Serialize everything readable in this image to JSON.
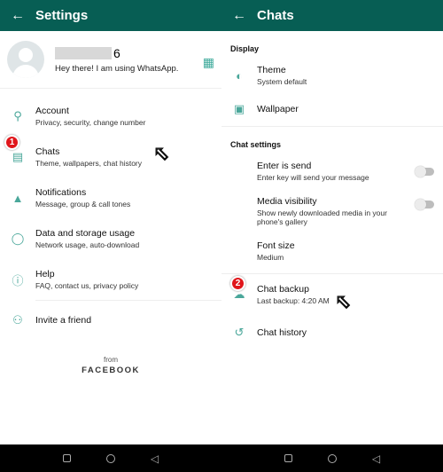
{
  "left": {
    "appbar": {
      "back_icon": "arrow-left-icon",
      "title": "Settings"
    },
    "profile": {
      "name_suffix": "6",
      "status": "Hey there! I am using WhatsApp.",
      "qr_icon": "qr-code-icon"
    },
    "items": [
      {
        "icon": "key-icon",
        "title": "Account",
        "subtitle": "Privacy, security, change number"
      },
      {
        "icon": "chat-icon",
        "title": "Chats",
        "subtitle": "Theme, wallpapers, chat history"
      },
      {
        "icon": "bell-icon",
        "title": "Notifications",
        "subtitle": "Message, group & call tones"
      },
      {
        "icon": "data-usage-icon",
        "title": "Data and storage usage",
        "subtitle": "Network usage, auto-download"
      },
      {
        "icon": "help-icon",
        "title": "Help",
        "subtitle": "FAQ, contact us, privacy policy"
      }
    ],
    "invite": {
      "icon": "people-icon",
      "title": "Invite a friend"
    },
    "footer": {
      "from": "from",
      "brand": "FACEBOOK"
    },
    "step_badge": "1"
  },
  "right": {
    "appbar": {
      "back_icon": "arrow-left-icon",
      "title": "Chats"
    },
    "display_section": "Display",
    "theme": {
      "title": "Theme",
      "subtitle": "System default"
    },
    "wallpaper": {
      "title": "Wallpaper"
    },
    "chat_settings_section": "Chat settings",
    "enter_is_send": {
      "title": "Enter is send",
      "subtitle": "Enter key will send your message",
      "enabled": false
    },
    "media_visibility": {
      "title": "Media visibility",
      "subtitle": "Show newly downloaded media in your phone's gallery",
      "enabled": false
    },
    "font_size": {
      "title": "Font size",
      "subtitle": "Medium"
    },
    "chat_backup": {
      "title": "Chat backup",
      "subtitle": "Last backup: 4:20 AM"
    },
    "chat_history": {
      "title": "Chat history"
    },
    "step_badge": "2"
  },
  "navbar": {
    "buttons": [
      "recents",
      "home",
      "back"
    ]
  },
  "colors": {
    "appbar": "#075e54",
    "accent": "#4aa79a",
    "badge": "#e0161b"
  }
}
